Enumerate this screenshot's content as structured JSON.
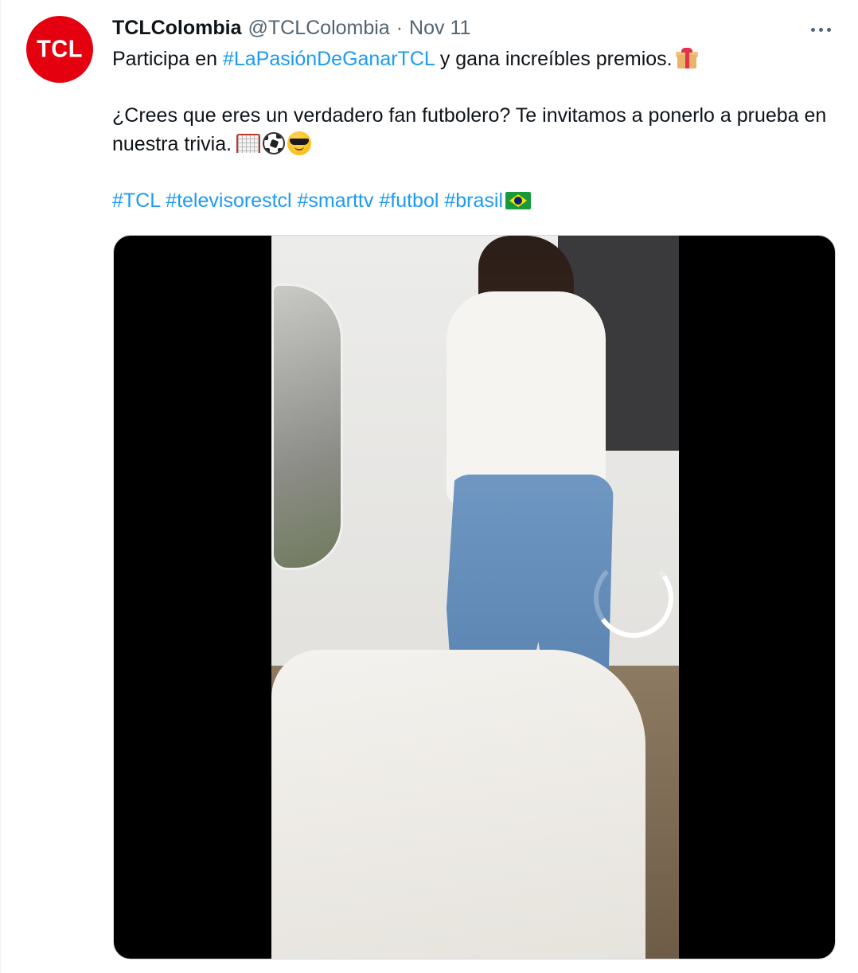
{
  "account": {
    "avatar_text": "TCL",
    "display_name": "TCLColombia",
    "handle": "@TCLColombia",
    "separator": "·",
    "date": "Nov 11",
    "avatar_color": "#e5000f"
  },
  "tweet": {
    "line1_prefix": "Participa en ",
    "line1_hashtag": "#LaPasiónDeGanarTCL",
    "line1_suffix": " y gana increíbles premios.",
    "line1_emoji": "gift-icon",
    "line2": "¿Crees que eres un verdadero fan futbolero? Te invitamos a ponerlo a prueba en nuestra trivia.",
    "line2_emojis": [
      "goal-net-icon",
      "soccer-ball-icon",
      "sunglasses-face-icon"
    ],
    "hashtags": [
      "#TCL",
      "#televisorestcl",
      "#smarttv",
      "#futbol",
      "#brasil"
    ],
    "hashtags_trailing_emoji": "brazil-flag-icon"
  },
  "media": {
    "type": "video",
    "state": "loading",
    "spinner_icon": "loading-spinner-icon"
  },
  "colors": {
    "link": "#1d9bf0",
    "text": "#0f1419",
    "secondary": "#536471"
  }
}
